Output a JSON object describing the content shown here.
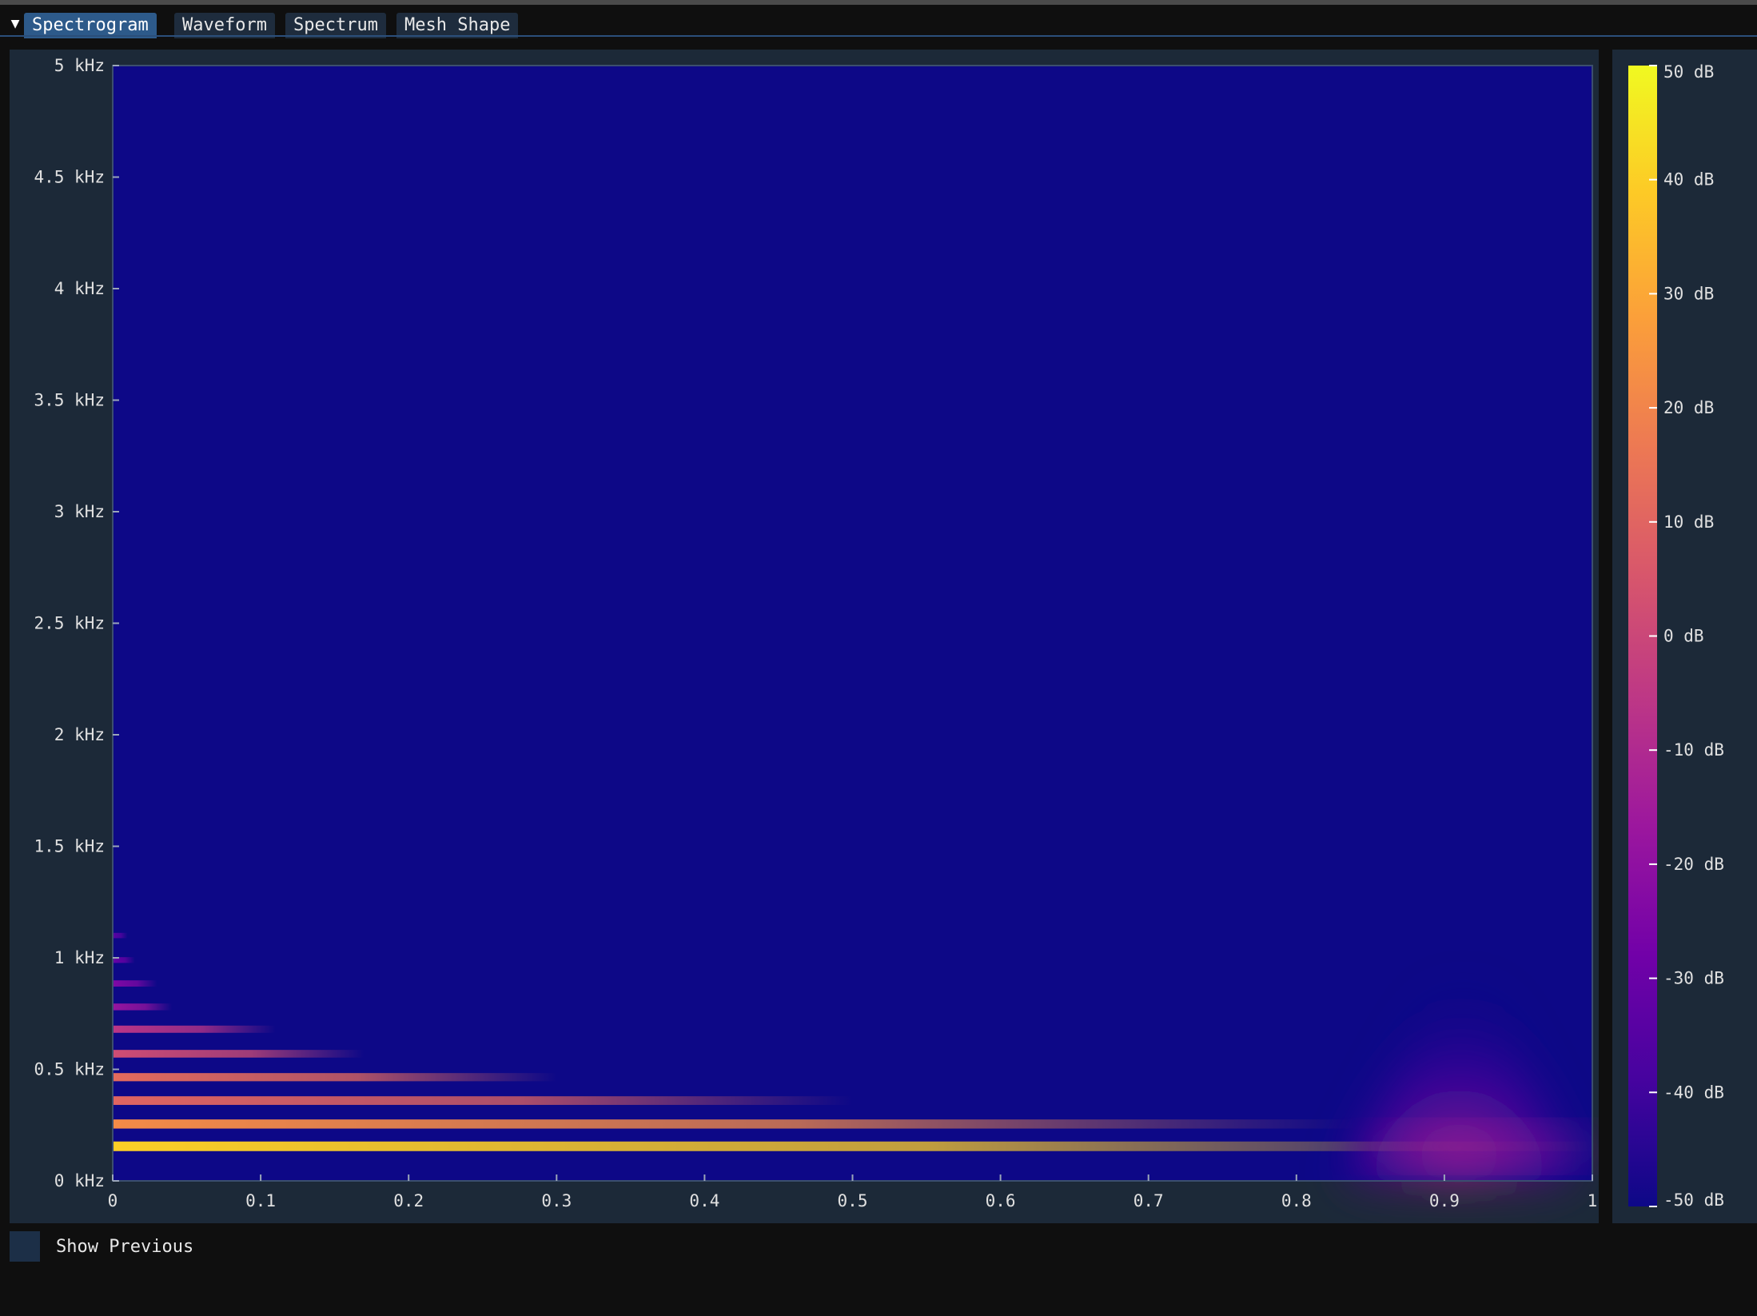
{
  "tabs": [
    {
      "label": "Spectrogram",
      "active": true
    },
    {
      "label": "Waveform",
      "active": false
    },
    {
      "label": "Spectrum",
      "active": false
    },
    {
      "label": "Mesh Shape",
      "active": false
    }
  ],
  "menu_icon": "triangle-down-icon",
  "colormap": [
    "#0d0887",
    "#46039f",
    "#7201a8",
    "#9c179e",
    "#bd3786",
    "#d8576b",
    "#ed7953",
    "#fb9f3a",
    "#fdca26",
    "#f0f921"
  ],
  "chart_data": {
    "type": "heatmap",
    "x": {
      "range": [
        0,
        1
      ],
      "ticks": [
        0,
        0.1,
        0.2,
        0.3,
        0.4,
        0.5,
        0.6,
        0.7,
        0.8,
        0.9,
        1
      ],
      "tick_labels": [
        "0",
        "0.1",
        "0.2",
        "0.3",
        "0.4",
        "0.5",
        "0.6",
        "0.7",
        "0.8",
        "0.9",
        "1"
      ]
    },
    "y": {
      "range": [
        0,
        5
      ],
      "unit": "kHz",
      "ticks": [
        0,
        0.5,
        1,
        1.5,
        2,
        2.5,
        3,
        3.5,
        4,
        4.5,
        5
      ],
      "tick_labels": [
        "0 kHz",
        "0.5 kHz",
        "1 kHz",
        "1.5 kHz",
        "2 kHz",
        "2.5 kHz",
        "3 kHz",
        "3.5 kHz",
        "4 kHz",
        "4.5 kHz",
        "5 kHz"
      ]
    },
    "colorbar": {
      "range": [
        -50,
        50
      ],
      "unit": "dB",
      "ticks": [
        50,
        40,
        30,
        20,
        10,
        0,
        -10,
        -20,
        -30,
        -40,
        -50
      ],
      "tick_labels": [
        "50 dB",
        "40 dB",
        "30 dB",
        "20 dB",
        "10 dB",
        "0 dB",
        "-10 dB",
        "-20 dB",
        "-30 dB",
        "-40 dB",
        "-50 dB"
      ]
    },
    "background_db": -50,
    "harmonics": [
      {
        "freq_khz": 0.155,
        "end_x": 1.0,
        "peak_db": 40
      },
      {
        "freq_khz": 0.255,
        "end_x": 0.84,
        "peak_db": 22
      },
      {
        "freq_khz": 0.36,
        "end_x": 0.5,
        "peak_db": 10
      },
      {
        "freq_khz": 0.465,
        "end_x": 0.3,
        "peak_db": 12
      },
      {
        "freq_khz": 0.57,
        "end_x": 0.17,
        "peak_db": 2
      },
      {
        "freq_khz": 0.68,
        "end_x": 0.11,
        "peak_db": -6
      },
      {
        "freq_khz": 0.78,
        "end_x": 0.04,
        "peak_db": -18
      },
      {
        "freq_khz": 0.885,
        "end_x": 0.03,
        "peak_db": -24
      },
      {
        "freq_khz": 0.99,
        "end_x": 0.015,
        "peak_db": -30
      },
      {
        "freq_khz": 1.1,
        "end_x": 0.01,
        "peak_db": -34
      }
    ],
    "transient": {
      "x_center": 0.915,
      "x_start": 0.83,
      "x_end": 0.99,
      "max_freq_khz": 1.1,
      "peak_db": -10
    }
  },
  "checkbox": {
    "label": "Show Previous",
    "checked": false
  }
}
